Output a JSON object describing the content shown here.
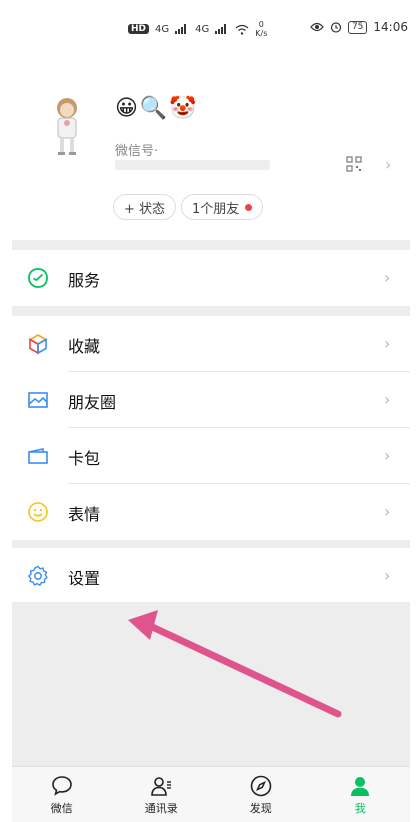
{
  "status_bar": {
    "network_badge": "HD",
    "signal_1": "4G",
    "signal_2": "4G",
    "speed_value": "0",
    "speed_unit": "K/s",
    "battery": "75",
    "time": "14:06"
  },
  "profile": {
    "emoji_name": "😀🔍🤡",
    "wxid_label": "微信号·",
    "status_chip": "+ 状态",
    "friends_chip": "1个朋友"
  },
  "menu": {
    "service": "服务",
    "favorites": "收藏",
    "moments": "朋友圈",
    "cards": "卡包",
    "stickers": "表情",
    "settings": "设置"
  },
  "tabbar": {
    "chats": "微信",
    "contacts": "通讯录",
    "discover": "发现",
    "me": "我"
  },
  "colors": {
    "accent": "#07c160",
    "arrow": "#e0548e"
  }
}
